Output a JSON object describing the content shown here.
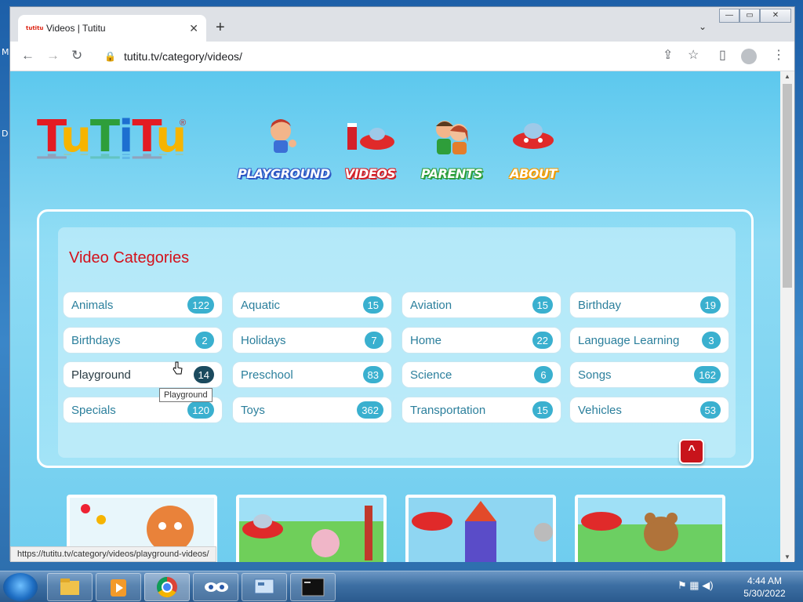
{
  "desktop": {
    "labels": [
      "M",
      "D"
    ]
  },
  "browser": {
    "tab": {
      "title": "Videos | Tutitu",
      "favicon_text": "tutitu",
      "close_icon": "✕"
    },
    "new_tab_icon": "+",
    "tab_search_icon": "⌄",
    "window_controls": {
      "minimize": "—",
      "maximize": "▭",
      "close": "✕"
    },
    "toolbar": {
      "back_icon": "←",
      "forward_icon": "→",
      "reload_icon": "↻",
      "lock_icon": "🔒",
      "url": "tutitu.tv/category/videos/",
      "share_icon": "⇪",
      "star_icon": "☆",
      "sidepanel_icon": "▯",
      "menu_icon": "⋮"
    },
    "status_url": "https://tutitu.tv/category/videos/playground-videos/"
  },
  "site": {
    "logo_letters": [
      "T",
      "u",
      "T",
      "i",
      "T",
      "u"
    ],
    "logo_reg": "®",
    "nav": [
      {
        "label": "PLAYGROUND",
        "color": "#2f57c4"
      },
      {
        "label": "VIDEOS",
        "color": "#d42028"
      },
      {
        "label": "PARENTS",
        "color": "#2e9e3a"
      },
      {
        "label": "ABOUT",
        "color": "#f29a00"
      }
    ],
    "panel_title": "Video Categories",
    "categories": [
      {
        "name": "Animals",
        "count": "122"
      },
      {
        "name": "Aquatic",
        "count": "15"
      },
      {
        "name": "Aviation",
        "count": "15"
      },
      {
        "name": "Birthday",
        "count": "19"
      },
      {
        "name": "Birthdays",
        "count": "2"
      },
      {
        "name": "Holidays",
        "count": "7"
      },
      {
        "name": "Home",
        "count": "22"
      },
      {
        "name": "Language Learning",
        "count": "3"
      },
      {
        "name": "Playground",
        "count": "14"
      },
      {
        "name": "Preschool",
        "count": "83"
      },
      {
        "name": "Science",
        "count": "6"
      },
      {
        "name": "Songs",
        "count": "162"
      },
      {
        "name": "Specials",
        "count": "120"
      },
      {
        "name": "Toys",
        "count": "362"
      },
      {
        "name": "Transportation",
        "count": "15"
      },
      {
        "name": "Vehicles",
        "count": "53"
      }
    ],
    "tooltip": "Playground",
    "up_button": "^"
  },
  "taskbar": {
    "time": "4:44 AM",
    "date": "5/30/2022"
  },
  "colors": {
    "accent_red": "#d4111b",
    "badge": "#3ab0cf",
    "badge_active": "#1b4a5e"
  }
}
